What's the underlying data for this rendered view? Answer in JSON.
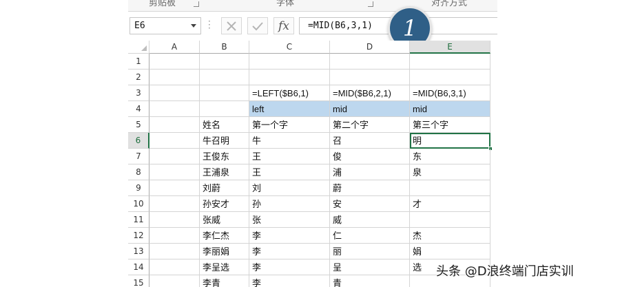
{
  "ribbon": {
    "groups": [
      "剪贴板",
      "字体",
      "对齐方式"
    ]
  },
  "formula_bar": {
    "name_box": "E6",
    "cancel_icon": "close-icon",
    "enter_icon": "check-icon",
    "function_label": "fx",
    "formula": "=MID(B6,3,1)"
  },
  "badge": {
    "step": "1",
    "color": "#2f5f87"
  },
  "sheet": {
    "columns": [
      "A",
      "B",
      "C",
      "D",
      "E"
    ],
    "active_column": "E",
    "active_row": "6",
    "highlight_color": "#bdd7ee",
    "selection_color": "#217346",
    "rows": [
      {
        "num": "1",
        "A": "",
        "B": "",
        "C": "",
        "D": "",
        "E": ""
      },
      {
        "num": "2",
        "A": "",
        "B": "",
        "C": "",
        "D": "",
        "E": ""
      },
      {
        "num": "3",
        "A": "",
        "B": "",
        "C": "=LEFT($B6,1)",
        "D": "=MID($B6,2,1)",
        "E": "=MID(B6,3,1)"
      },
      {
        "num": "4",
        "A": "",
        "B": "",
        "C": "left",
        "D": "mid",
        "E": "mid"
      },
      {
        "num": "5",
        "A": "",
        "B": "姓名",
        "C": "第一个字",
        "D": "第二个字",
        "E": "第三个字"
      },
      {
        "num": "6",
        "A": "",
        "B": "牛召明",
        "C": "牛",
        "D": "召",
        "E": "明"
      },
      {
        "num": "7",
        "A": "",
        "B": "王俊东",
        "C": "王",
        "D": "俊",
        "E": "东"
      },
      {
        "num": "8",
        "A": "",
        "B": "王浦泉",
        "C": "王",
        "D": "浦",
        "E": "泉"
      },
      {
        "num": "9",
        "A": "",
        "B": "刘蔚",
        "C": "刘",
        "D": "蔚",
        "E": ""
      },
      {
        "num": "10",
        "A": "",
        "B": "孙安才",
        "C": "孙",
        "D": "安",
        "E": "才"
      },
      {
        "num": "11",
        "A": "",
        "B": "张威",
        "C": "张",
        "D": "威",
        "E": ""
      },
      {
        "num": "12",
        "A": "",
        "B": "李仁杰",
        "C": "李",
        "D": "仁",
        "E": "杰"
      },
      {
        "num": "13",
        "A": "",
        "B": "李丽娟",
        "C": "李",
        "D": "丽",
        "E": "娟"
      },
      {
        "num": "14",
        "A": "",
        "B": "李呈选",
        "C": "李",
        "D": "呈",
        "E": "选"
      },
      {
        "num": "15",
        "A": "",
        "B": "李青",
        "C": "李",
        "D": "青",
        "E": ""
      }
    ]
  },
  "watermark": "头条 @D浪终端门店实训"
}
